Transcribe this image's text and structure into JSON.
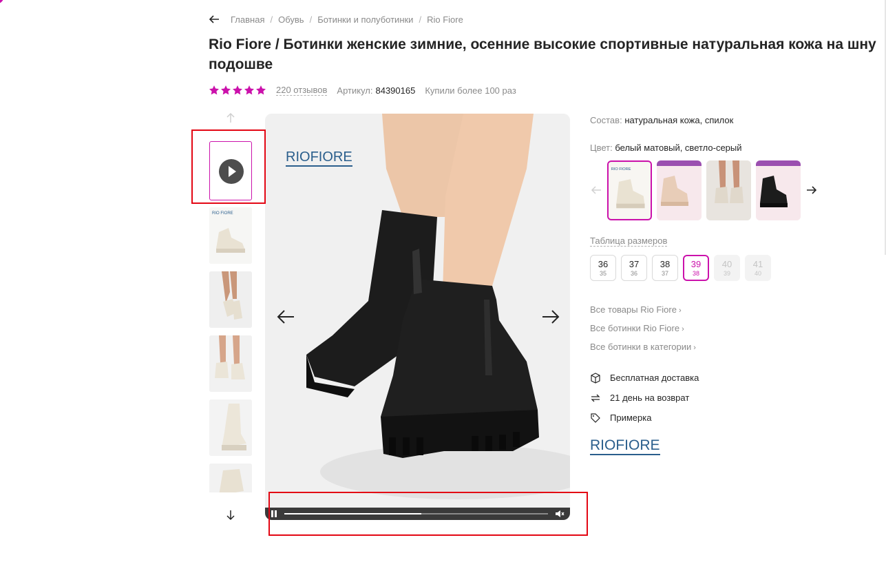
{
  "colors": {
    "accent": "#cb11ab",
    "annotation": "#e30613",
    "brand_blue": "#2a5e8c",
    "text": "#242424",
    "muted": "#8a8a8a"
  },
  "breadcrumbs": {
    "back_icon": "arrow-left-icon",
    "items": [
      "Главная",
      "Обувь",
      "Ботинки и полуботинки",
      "Rio Fiore"
    ],
    "separator": "/"
  },
  "product": {
    "title_line1": "Rio Fiore / Ботинки женские зимние, осенние высокие спортивные натуральная кожа на шну",
    "title_line2": "подошве",
    "rating": 5,
    "reviews": "220 отзывов",
    "article_label": "Артикул:",
    "article_value": "84390165",
    "bought": "Купили более 100 раз"
  },
  "gallery": {
    "thumb_count": 6,
    "brand_logo": "RIO FIORE",
    "brand_logo_a": "RIO",
    "brand_logo_b": "FIORE",
    "video_progress": 0.52
  },
  "info": {
    "composition_label": "Состав:",
    "composition_value": "натуральная кожа, спилок",
    "color_label": "Цвет:",
    "color_value": "белый матовый, светло-серый",
    "size_table": "Таблица размеров",
    "sizes": [
      {
        "ru": "36",
        "eu": "35",
        "state": "normal"
      },
      {
        "ru": "37",
        "eu": "36",
        "state": "normal"
      },
      {
        "ru": "38",
        "eu": "37",
        "state": "normal"
      },
      {
        "ru": "39",
        "eu": "38",
        "state": "selected"
      },
      {
        "ru": "40",
        "eu": "39",
        "state": "disabled"
      },
      {
        "ru": "41",
        "eu": "40",
        "state": "disabled"
      }
    ],
    "links": [
      "Все товары Rio Fiore",
      "Все ботинки Rio Fiore",
      "Все ботинки в категории"
    ],
    "features": [
      {
        "icon": "box-icon",
        "text": "Бесплатная доставка"
      },
      {
        "icon": "return-arrows-icon",
        "text": "21 день на возврат"
      },
      {
        "icon": "tag-icon",
        "text": "Примерка"
      }
    ],
    "brand_logo_a": "RIO",
    "brand_logo_b": "FIORE"
  }
}
